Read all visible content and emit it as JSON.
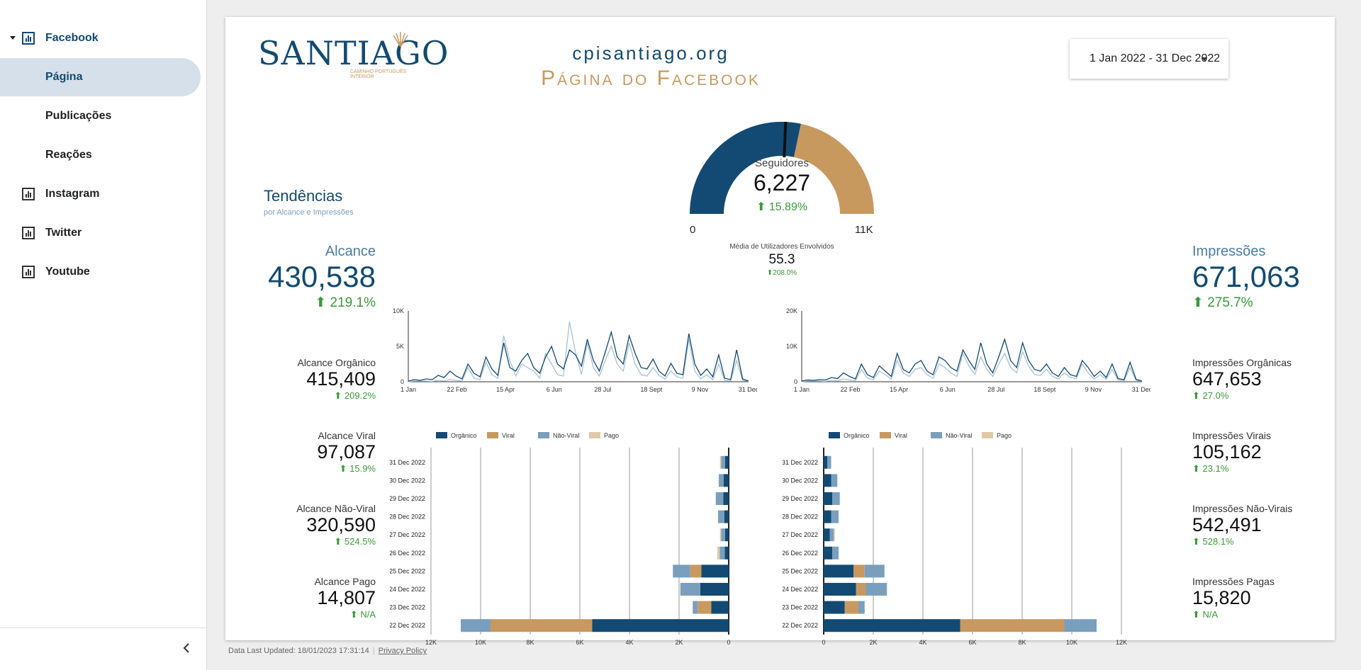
{
  "sidebar": {
    "items": [
      {
        "label": "Facebook",
        "icon": "bar-chart-icon",
        "expanded": true
      },
      {
        "label": "Página",
        "active": true
      },
      {
        "label": "Publicações"
      },
      {
        "label": "Reações"
      },
      {
        "label": "Instagram",
        "icon": "bar-chart-icon"
      },
      {
        "label": "Twitter",
        "icon": "bar-chart-icon"
      },
      {
        "label": "Youtube",
        "icon": "bar-chart-icon"
      }
    ],
    "collapse_icon": "chevron-left-icon"
  },
  "header": {
    "logo_text": "SANTIAGO",
    "logo_sub": "CAMINHO PORTUGUÊS INTERIOR",
    "title_line1": "cpisantiago.org",
    "title_line2": "Página do Facebook",
    "date_range": "1 Jan 2022 - 31 Dec 2022"
  },
  "trends": {
    "title": "Tendências",
    "subtitle": "por Alcance e Impressões"
  },
  "gauge": {
    "label": "Seguidores",
    "value": "6,227",
    "delta": "15.89%",
    "min": "0",
    "max": "11K",
    "fraction": 0.566
  },
  "engaged": {
    "label": "Média de Utilizadores Envolvidos",
    "value": "55.3",
    "delta": "208.0%"
  },
  "reach": {
    "label": "Alcance",
    "value": "430,538",
    "delta": "219.1%",
    "kpis": [
      {
        "label": "Alcance Orgânico",
        "value": "415,409",
        "delta": "209.2%"
      },
      {
        "label": "Alcance Viral",
        "value": "97,087",
        "delta": "15.9%"
      },
      {
        "label": "Alcance Não-Viral",
        "value": "320,590",
        "delta": "524.5%"
      },
      {
        "label": "Alcance Pago",
        "value": "14,807",
        "delta": "N/A"
      }
    ]
  },
  "impressions": {
    "label": "Impressões",
    "value": "671,063",
    "delta": "275.7%",
    "kpis": [
      {
        "label": "Impressões Orgânicas",
        "value": "647,653",
        "delta": "27.0%"
      },
      {
        "label": "Impressões Virais",
        "value": "105,162",
        "delta": "23.1%"
      },
      {
        "label": "Impressões Não-Virais",
        "value": "542,491",
        "delta": "528.1%"
      },
      {
        "label": "Impressões Pagas",
        "value": "15,820",
        "delta": "N/A"
      }
    ]
  },
  "legend": [
    "Orgânico",
    "Viral",
    "Não-Viral",
    "Pago"
  ],
  "colors": {
    "organic": "#124a73",
    "viral": "#c8995f",
    "nonviral": "#7a9fbd",
    "paid": "#e0c9a6",
    "positive": "#3a9a3a",
    "accent": "#124a73"
  },
  "footer": {
    "updated": "Data Last Updated: 18/01/2023 17:31:14",
    "privacy": "Privacy Policy"
  },
  "chart_data": [
    {
      "type": "line",
      "name": "reach-timeseries",
      "x_ticks": [
        "1 Jan",
        "22 Feb",
        "15 Apr",
        "6 Jun",
        "28 Jul",
        "18 Sept",
        "9 Nov",
        "31 Dec"
      ],
      "y_ticks": [
        "0",
        "5K",
        "10K"
      ],
      "ylim": [
        0,
        10000
      ],
      "series": [
        {
          "name": "Orgânico",
          "values": [
            100,
            300,
            200,
            400,
            300,
            900,
            600,
            1500,
            800,
            400,
            2500,
            1200,
            700,
            3500,
            1800,
            900,
            5500,
            2000,
            1500,
            3000,
            4000,
            2000,
            1200,
            3500,
            5000,
            2500,
            1800,
            4500,
            3800,
            2200,
            6000,
            3000,
            1500,
            4200,
            7000,
            3500,
            2500,
            6500,
            4000,
            2000,
            1800,
            3200,
            1500,
            800,
            2600,
            1200,
            1000,
            6800,
            2500,
            900,
            1800,
            700,
            3800,
            500,
            300,
            4500,
            400,
            100
          ]
        },
        {
          "name": "Não-Viral",
          "values": [
            0,
            100,
            100,
            100,
            50,
            200,
            100,
            300,
            200,
            100,
            2000,
            500,
            300,
            2800,
            1000,
            500,
            6500,
            3000,
            800,
            2500,
            2000,
            1500,
            500,
            4000,
            2500,
            1000,
            800,
            8500,
            4200,
            1000,
            5500,
            2000,
            800,
            3000,
            5000,
            2500,
            1500,
            5500,
            2500,
            1000,
            800,
            2000,
            900,
            400,
            1500,
            700,
            500,
            6000,
            1500,
            400,
            1000,
            300,
            2500,
            200,
            100,
            3000,
            200,
            50
          ]
        }
      ]
    },
    {
      "type": "line",
      "name": "impressions-timeseries",
      "x_ticks": [
        "1 Jan",
        "22 Feb",
        "15 Apr",
        "6 Jun",
        "28 Jul",
        "18 Sept",
        "9 Nov",
        "31 Dec"
      ],
      "y_ticks": [
        "0",
        "10K",
        "20K"
      ],
      "ylim": [
        0,
        20000
      ],
      "series": [
        {
          "name": "Orgânico",
          "values": [
            200,
            500,
            400,
            600,
            500,
            1200,
            900,
            2500,
            1500,
            800,
            5000,
            2000,
            1200,
            4500,
            3000,
            1500,
            8000,
            3500,
            2500,
            5000,
            6000,
            3000,
            2000,
            7000,
            6000,
            4000,
            3000,
            9000,
            6000,
            3500,
            11000,
            5000,
            2500,
            7000,
            12000,
            6000,
            4000,
            11000,
            6000,
            3500,
            3000,
            5000,
            2500,
            1500,
            4000,
            2000,
            1500,
            6000,
            4000,
            1500,
            3000,
            1200,
            5000,
            900,
            600,
            5500,
            700,
            200
          ]
        },
        {
          "name": "Não-Viral",
          "values": [
            0,
            200,
            200,
            200,
            100,
            400,
            200,
            800,
            500,
            300,
            3500,
            1000,
            600,
            3000,
            2000,
            800,
            6000,
            2500,
            1500,
            3500,
            4000,
            2000,
            1000,
            5000,
            4000,
            2500,
            1500,
            8000,
            4500,
            2000,
            7000,
            3500,
            1500,
            5000,
            8000,
            4000,
            2500,
            8500,
            4500,
            2000,
            1800,
            3500,
            1500,
            800,
            2500,
            1200,
            900,
            5000,
            2500,
            800,
            2000,
            700,
            3500,
            500,
            300,
            4000,
            400,
            100
          ]
        }
      ]
    },
    {
      "type": "bar",
      "name": "reach-daily-stacked",
      "orientation": "horizontal-reversed",
      "categories": [
        "31 Dec 2022",
        "30 Dec 2022",
        "29 Dec 2022",
        "28 Dec 2022",
        "27 Dec 2022",
        "26 Dec 2022",
        "25 Dec 2022",
        "24 Dec 2022",
        "23 Dec 2022",
        "22 Dec 2022"
      ],
      "x_ticks": [
        "12K",
        "10K",
        "8K",
        "6K",
        "4K",
        "2K",
        "0"
      ],
      "xlim": [
        0,
        12000
      ],
      "series": [
        {
          "name": "Orgânico",
          "values": [
            150,
            200,
            220,
            180,
            150,
            160,
            1100,
            1150,
            700,
            5500
          ]
        },
        {
          "name": "Viral",
          "values": [
            0,
            0,
            0,
            0,
            0,
            0,
            450,
            0,
            550,
            4100
          ]
        },
        {
          "name": "Não-Viral",
          "values": [
            150,
            200,
            300,
            250,
            150,
            200,
            700,
            800,
            200,
            1200
          ]
        },
        {
          "name": "Pago",
          "values": [
            50,
            0,
            0,
            0,
            50,
            100,
            0,
            0,
            0,
            0
          ]
        }
      ]
    },
    {
      "type": "bar",
      "name": "impressions-daily-stacked",
      "orientation": "horizontal",
      "categories": [
        "31 Dec 2022",
        "30 Dec 2022",
        "29 Dec 2022",
        "28 Dec 2022",
        "27 Dec 2022",
        "26 Dec 2022",
        "25 Dec 2022",
        "24 Dec 2022",
        "23 Dec 2022",
        "22 Dec 2022"
      ],
      "x_ticks": [
        "0",
        "2K",
        "4K",
        "6K",
        "8K",
        "10K",
        "12K"
      ],
      "xlim": [
        0,
        12000
      ],
      "series": [
        {
          "name": "Orgânico",
          "values": [
            150,
            300,
            350,
            300,
            250,
            350,
            1200,
            1300,
            850,
            5500
          ]
        },
        {
          "name": "Viral",
          "values": [
            0,
            0,
            0,
            0,
            0,
            0,
            450,
            400,
            550,
            4200
          ]
        },
        {
          "name": "Não-Viral",
          "values": [
            150,
            250,
            300,
            300,
            150,
            250,
            800,
            850,
            250,
            1300
          ]
        },
        {
          "name": "Pago",
          "values": [
            0,
            0,
            0,
            0,
            50,
            0,
            0,
            0,
            0,
            0
          ]
        }
      ]
    }
  ]
}
